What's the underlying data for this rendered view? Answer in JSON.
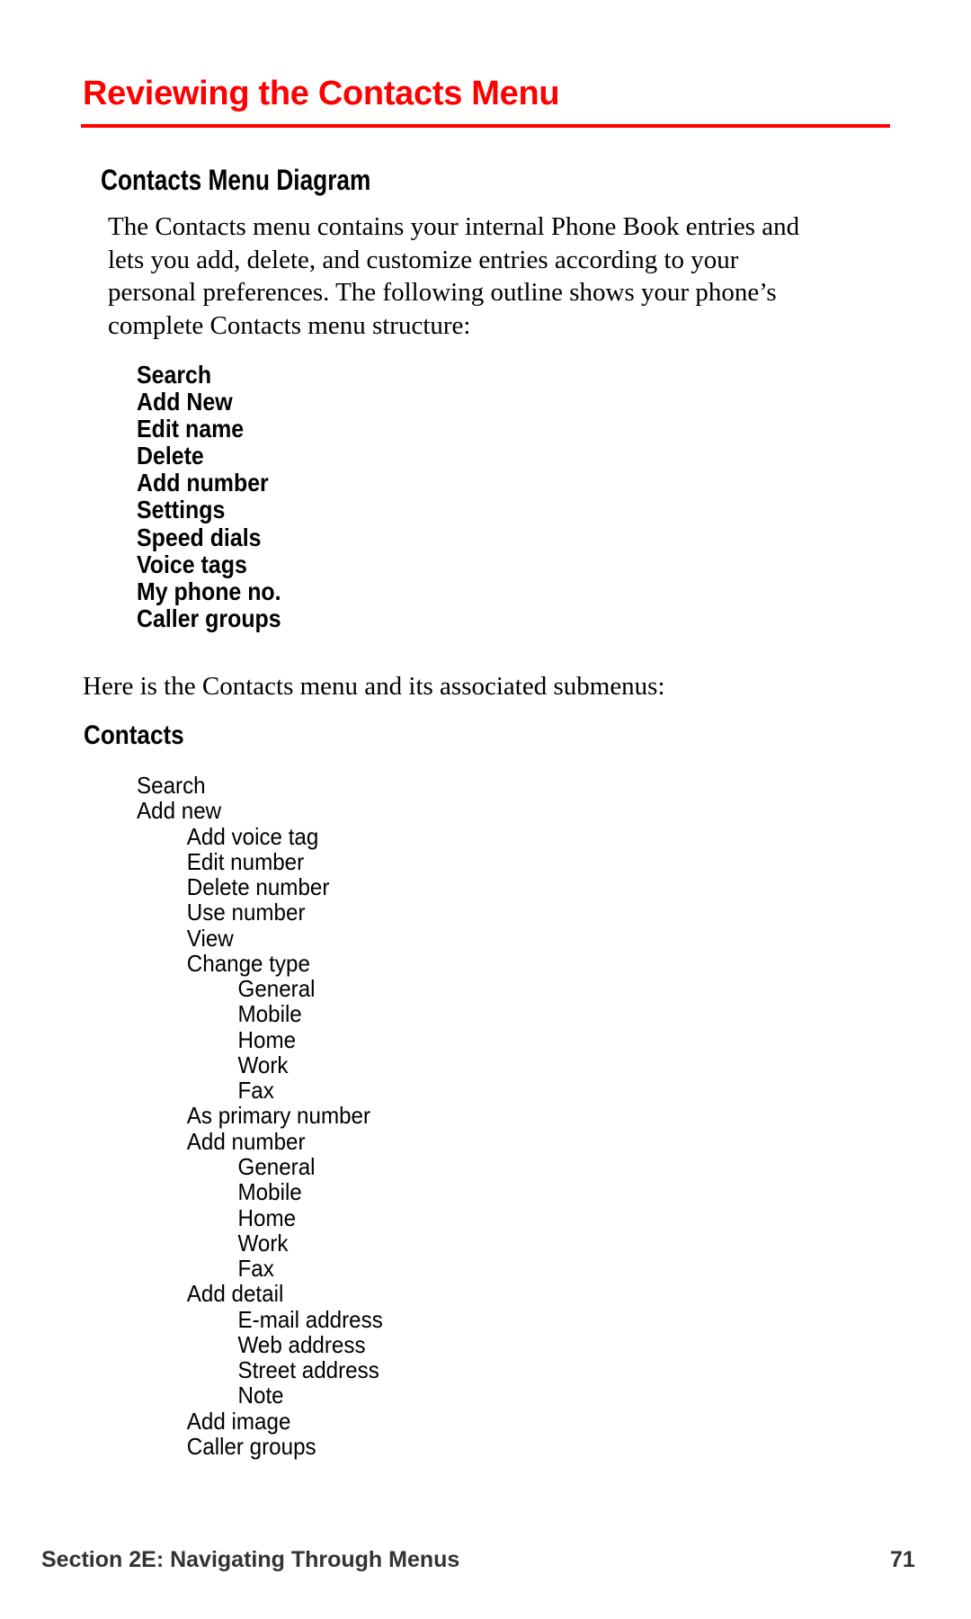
{
  "colors": {
    "accent": "#ff0000",
    "text": "#000000",
    "footer": "#333333"
  },
  "page": {
    "title": "Reviewing the Contacts Menu",
    "section_heading": "Contacts Menu Diagram",
    "intro_paragraph_lines": [
      "The Contacts menu contains your internal Phone Book entries and",
      "lets you add, delete, and customize entries according to your",
      "personal preferences. The following outline shows your phone’s",
      "complete Contacts menu structure:"
    ],
    "top_level_items": [
      "Search",
      "Add New",
      "Edit name",
      "Delete",
      "Add number",
      "Settings",
      "Speed dials",
      "Voice tags",
      "My phone no.",
      "Caller groups"
    ],
    "submenu_intro": "Here is the Contacts menu and its associated submenus:",
    "submenu_heading": "Contacts",
    "submenu_tree": [
      {
        "level": 1,
        "label": "Search"
      },
      {
        "level": 1,
        "label": "Add new"
      },
      {
        "level": 2,
        "label": "Add voice tag"
      },
      {
        "level": 2,
        "label": "Edit number"
      },
      {
        "level": 2,
        "label": "Delete number"
      },
      {
        "level": 2,
        "label": "Use number"
      },
      {
        "level": 2,
        "label": "View"
      },
      {
        "level": 2,
        "label": "Change type"
      },
      {
        "level": 3,
        "label": "General"
      },
      {
        "level": 3,
        "label": "Mobile"
      },
      {
        "level": 3,
        "label": "Home"
      },
      {
        "level": 3,
        "label": "Work"
      },
      {
        "level": 3,
        "label": "Fax"
      },
      {
        "level": 2,
        "label": "As primary number"
      },
      {
        "level": 2,
        "label": "Add number"
      },
      {
        "level": 3,
        "label": "General"
      },
      {
        "level": 3,
        "label": "Mobile"
      },
      {
        "level": 3,
        "label": "Home"
      },
      {
        "level": 3,
        "label": "Work"
      },
      {
        "level": 3,
        "label": "Fax"
      },
      {
        "level": 2,
        "label": "Add detail"
      },
      {
        "level": 3,
        "label": "E-mail address"
      },
      {
        "level": 3,
        "label": "Web address"
      },
      {
        "level": 3,
        "label": "Street address"
      },
      {
        "level": 3,
        "label": "Note"
      },
      {
        "level": 2,
        "label": "Add image"
      },
      {
        "level": 2,
        "label": "Caller groups"
      }
    ]
  },
  "footer": {
    "section_label": "Section 2E: Navigating Through Menus",
    "page_number": "71"
  }
}
